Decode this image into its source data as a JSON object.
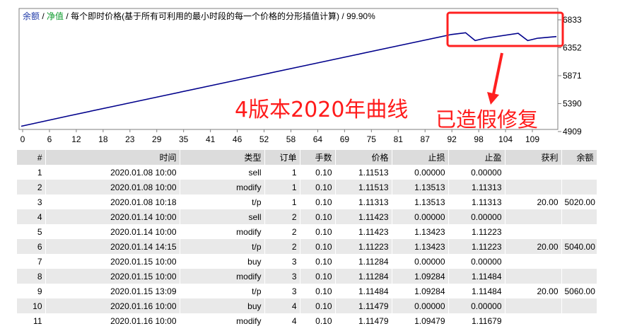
{
  "legend": {
    "balance": "余额",
    "sep1": " / ",
    "equity": "净值",
    "sep2": " / ",
    "description": "每个即时价格(基于所有可利用的最小时段的每一个价格的分形插值计算)",
    "sep3": " / ",
    "quality": "99.90%"
  },
  "overlay": {
    "curve_label": "4版本2020年曲线",
    "fixed_label": "已造假修复"
  },
  "chart_data": {
    "type": "line",
    "title": "",
    "xlabel": "",
    "ylabel": "",
    "x_ticks": [
      "0",
      "6",
      "12",
      "18",
      "23",
      "29",
      "35",
      "41",
      "46",
      "52",
      "58",
      "64",
      "69",
      "75",
      "81",
      "87",
      "92",
      "98",
      "104",
      "109"
    ],
    "y_ticks": [
      "6833",
      "6352",
      "5871",
      "5390",
      "4909"
    ],
    "ylim": [
      4909,
      6833
    ],
    "xlim": [
      0,
      112
    ],
    "series": [
      {
        "color": "#00008b",
        "points": [
          [
            0,
            5000
          ],
          [
            10,
            5180
          ],
          [
            20,
            5355
          ],
          [
            30,
            5530
          ],
          [
            40,
            5705
          ],
          [
            50,
            5880
          ],
          [
            60,
            6055
          ],
          [
            70,
            6230
          ],
          [
            80,
            6405
          ],
          [
            90,
            6580
          ],
          [
            93,
            6610
          ],
          [
            95,
            6475
          ],
          [
            97,
            6515
          ],
          [
            104,
            6600
          ],
          [
            106,
            6475
          ],
          [
            108,
            6515
          ],
          [
            112,
            6545
          ]
        ]
      }
    ],
    "grid": false,
    "legend": "top-left",
    "highlight_box_color": "#ff2020"
  },
  "table": {
    "headers": [
      "#",
      "时间",
      "类型",
      "订单",
      "手数",
      "价格",
      "止损",
      "止盈",
      "获利",
      "余额"
    ],
    "rows": [
      [
        "1",
        "2020.01.08 10:00",
        "sell",
        "1",
        "0.10",
        "1.11513",
        "0.00000",
        "0.00000",
        "",
        ""
      ],
      [
        "2",
        "2020.01.08 10:00",
        "modify",
        "1",
        "0.10",
        "1.11513",
        "1.13513",
        "1.11313",
        "",
        ""
      ],
      [
        "3",
        "2020.01.08 10:18",
        "t/p",
        "1",
        "0.10",
        "1.11313",
        "1.13513",
        "1.11313",
        "20.00",
        "5020.00"
      ],
      [
        "4",
        "2020.01.14 10:00",
        "sell",
        "2",
        "0.10",
        "1.11423",
        "0.00000",
        "0.00000",
        "",
        ""
      ],
      [
        "5",
        "2020.01.14 10:00",
        "modify",
        "2",
        "0.10",
        "1.11423",
        "1.13423",
        "1.11223",
        "",
        ""
      ],
      [
        "6",
        "2020.01.14 14:15",
        "t/p",
        "2",
        "0.10",
        "1.11223",
        "1.13423",
        "1.11223",
        "20.00",
        "5040.00"
      ],
      [
        "7",
        "2020.01.15 10:00",
        "buy",
        "3",
        "0.10",
        "1.11284",
        "0.00000",
        "0.00000",
        "",
        ""
      ],
      [
        "8",
        "2020.01.15 10:00",
        "modify",
        "3",
        "0.10",
        "1.11284",
        "1.09284",
        "1.11484",
        "",
        ""
      ],
      [
        "9",
        "2020.01.15 13:09",
        "t/p",
        "3",
        "0.10",
        "1.11484",
        "1.09284",
        "1.11484",
        "20.00",
        "5060.00"
      ],
      [
        "10",
        "2020.01.16 10:00",
        "buy",
        "4",
        "0.10",
        "1.11479",
        "0.00000",
        "0.00000",
        "",
        ""
      ],
      [
        "11",
        "2020.01.16 10:00",
        "modify",
        "4",
        "0.10",
        "1.11479",
        "1.09479",
        "1.11679",
        "",
        ""
      ]
    ]
  }
}
